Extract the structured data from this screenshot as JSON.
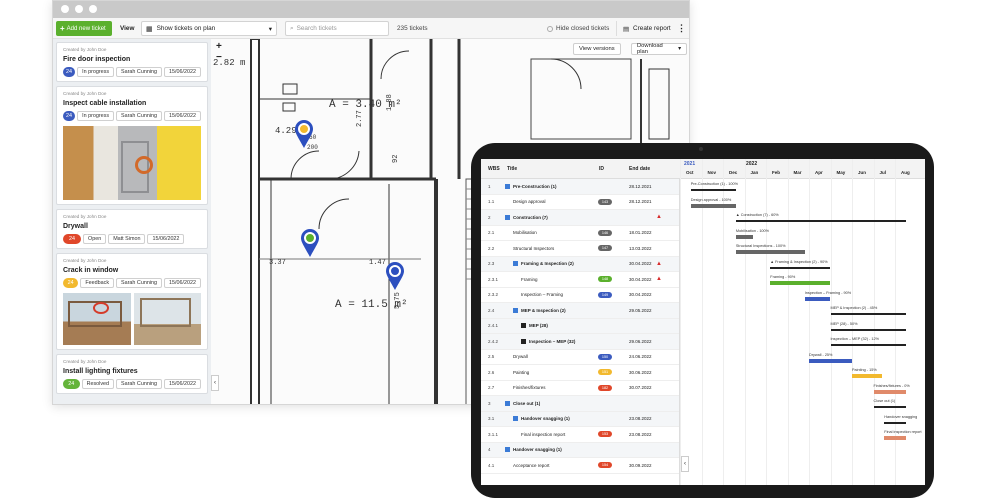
{
  "toolbar": {
    "add_ticket": "Add new ticket",
    "view_label": "View",
    "view_select": "Show tickets on plan",
    "search_placeholder": "Search tickets",
    "ticket_count": "235 tickets",
    "hide_closed": "Hide closed tickets",
    "create_report": "Create report"
  },
  "tickets": [
    {
      "creator": "Created by John Doe",
      "title": "Fire door inspection",
      "number": "24",
      "number_color": "#3b5bbf",
      "status": "In progress",
      "assignee": "Sarah Cunning",
      "date": "15/06/2022"
    },
    {
      "creator": "Created by John Doe",
      "title": "Inspect cable installation",
      "number": "24",
      "number_color": "#3b5bbf",
      "status": "In progress",
      "assignee": "Sarah Cunning",
      "date": "15/06/2022"
    },
    {
      "creator": "Created by John Doe",
      "title": "Drywall",
      "number": "24",
      "number_color": "#e0472a",
      "status": "Open",
      "assignee": "Matt Simon",
      "date": "15/06/2022"
    },
    {
      "creator": "Created by John Doe",
      "title": "Crack in window",
      "number": "24",
      "number_color": "#f2b92e",
      "status": "Feedback",
      "assignee": "Sarah Cunning",
      "date": "15/06/2022"
    },
    {
      "creator": "Created by John Doe",
      "title": "Install lighting fixtures",
      "number": "24",
      "number_color": "#64b43a",
      "status": "Resolved",
      "assignee": "Sarah Cunning",
      "date": "15/06/2022"
    }
  ],
  "plan": {
    "view_versions": "View versions",
    "download_plan": "Download plan",
    "dims": {
      "d1": "2.82 m",
      "d2": "A = 3.40 m²",
      "d3": "4.29",
      "d4": "A = 11.5 m²",
      "d5": "3.37",
      "d6": "1.47",
      "d7": "1.88",
      "d8": "2.77",
      "d9": "92",
      "d10": "5.75",
      "d11": "60",
      "d12": "200"
    }
  },
  "gantt": {
    "headers": {
      "wbs": "WBS",
      "title": "Title",
      "id": "ID",
      "end": "End date"
    },
    "years": [
      "2021",
      "2022"
    ],
    "months": [
      "Oct",
      "Nov",
      "Dec",
      "Jan",
      "Feb",
      "Mar",
      "Apr",
      "May",
      "Jun",
      "Jul",
      "Aug"
    ],
    "rows": [
      {
        "wbs": "1",
        "name": "Pre-Construction (1)",
        "group": true,
        "indent": 0,
        "id": "",
        "id_color": "",
        "end": "28.12.2021",
        "warn": false
      },
      {
        "wbs": "1.1",
        "name": "Design approval",
        "group": false,
        "indent": 1,
        "id": "143",
        "id_color": "#666",
        "end": "28.12.2021",
        "warn": false
      },
      {
        "wbs": "2",
        "name": "Construction (7)",
        "group": true,
        "indent": 0,
        "id": "",
        "id_color": "",
        "end": "",
        "warn": true
      },
      {
        "wbs": "2.1",
        "name": "Mobilisation",
        "group": false,
        "indent": 1,
        "id": "146",
        "id_color": "#666",
        "end": "18.01.2022",
        "warn": false
      },
      {
        "wbs": "2.2",
        "name": "Structural Inspectors",
        "group": false,
        "indent": 1,
        "id": "147",
        "id_color": "#666",
        "end": "13.03.2022",
        "warn": false
      },
      {
        "wbs": "2.3",
        "name": "Framing & Inspection (2)",
        "group": true,
        "indent": 1,
        "id": "",
        "id_color": "",
        "end": "30.04.2022",
        "warn": true
      },
      {
        "wbs": "2.3.1",
        "name": "Framing",
        "group": false,
        "indent": 2,
        "id": "148",
        "id_color": "#5bb02d",
        "end": "30.04.2022",
        "warn": true
      },
      {
        "wbs": "2.3.2",
        "name": "Inspection – Framing",
        "group": false,
        "indent": 2,
        "id": "149",
        "id_color": "#3b5bbf",
        "end": "30.04.2022",
        "warn": false
      },
      {
        "wbs": "2.4",
        "name": "MEP & Inspection (2)",
        "group": true,
        "indent": 1,
        "id": "",
        "id_color": "",
        "end": "29.05.2022",
        "warn": false
      },
      {
        "wbs": "2.4.1",
        "name": "MEP (28)",
        "group": true,
        "indent": 2,
        "id": "",
        "id_color": "",
        "end": "",
        "warn": false
      },
      {
        "wbs": "2.4.2",
        "name": "Inspection – MEP (32)",
        "group": true,
        "indent": 2,
        "id": "",
        "id_color": "",
        "end": "29.06.2022",
        "warn": false
      },
      {
        "wbs": "2.5",
        "name": "Drywall",
        "group": false,
        "indent": 1,
        "id": "150",
        "id_color": "#3b5bbf",
        "end": "24.06.2022",
        "warn": false
      },
      {
        "wbs": "2.6",
        "name": "Painting",
        "group": false,
        "indent": 1,
        "id": "151",
        "id_color": "#f2b92e",
        "end": "30.06.2022",
        "warn": false
      },
      {
        "wbs": "2.7",
        "name": "Finishes/fixtures",
        "group": false,
        "indent": 1,
        "id": "182",
        "id_color": "#e0472a",
        "end": "30.07.2022",
        "warn": false
      },
      {
        "wbs": "3",
        "name": "Close out (1)",
        "group": true,
        "indent": 0,
        "id": "",
        "id_color": "",
        "end": "",
        "warn": false
      },
      {
        "wbs": "3.1",
        "name": "Handover snagging (1)",
        "group": true,
        "indent": 1,
        "id": "",
        "id_color": "",
        "end": "23.08.2022",
        "warn": false
      },
      {
        "wbs": "3.1.1",
        "name": "Final inspection report",
        "group": false,
        "indent": 2,
        "id": "153",
        "id_color": "#e0472a",
        "end": "23.08.2022",
        "warn": false
      },
      {
        "wbs": "4",
        "name": "Handover snagging (1)",
        "group": true,
        "indent": 0,
        "id": "",
        "id_color": "",
        "end": "",
        "warn": false
      },
      {
        "wbs": "4.1",
        "name": "Acceptance report",
        "group": false,
        "indent": 1,
        "id": "154",
        "id_color": "#e0472a",
        "end": "30.09.2022",
        "warn": false
      }
    ],
    "bars": [
      {
        "label": "Pre-Construction (1) - 100%",
        "start": 0.5,
        "end": 2.6,
        "color": "#222",
        "thin": true,
        "row": 0
      },
      {
        "label": "Design approval - 100%",
        "start": 0.5,
        "end": 2.6,
        "color": "#666",
        "row": 1
      },
      {
        "label": "Construction (7) - 60%",
        "start": 2.6,
        "end": 10.5,
        "color": "#222",
        "thin": true,
        "row": 2,
        "warn": true
      },
      {
        "label": "Mobilisation - 100%",
        "start": 2.6,
        "end": 3.4,
        "color": "#666",
        "row": 3
      },
      {
        "label": "Structural Inspections - 100%",
        "start": 2.6,
        "end": 5.8,
        "color": "#666",
        "row": 4
      },
      {
        "label": "Framing & Inspection (2) - 90%",
        "start": 4.2,
        "end": 7.0,
        "color": "#222",
        "thin": true,
        "row": 5,
        "warn": true
      },
      {
        "label": "Framing - 90%",
        "start": 4.2,
        "end": 7.0,
        "color": "#5bb02d",
        "row": 6
      },
      {
        "label": "Inspection – Framing - 90%",
        "start": 5.8,
        "end": 7.0,
        "color": "#3b5bbf",
        "row": 7
      },
      {
        "label": "MEP & Inspection (2) - 45%",
        "start": 7.0,
        "end": 10.5,
        "color": "#222",
        "thin": true,
        "row": 8
      },
      {
        "label": "MEP (28) - 50%",
        "start": 7.0,
        "end": 10.5,
        "color": "#222",
        "thin": true,
        "row": 9
      },
      {
        "label": "Inspection – MEP (32) - 12%",
        "start": 7.0,
        "end": 10.5,
        "color": "#222",
        "thin": true,
        "row": 10
      },
      {
        "label": "Drywall - 25%",
        "start": 6.0,
        "end": 8.0,
        "color": "#3b5bbf",
        "row": 11
      },
      {
        "label": "Painting - 15%",
        "start": 8.0,
        "end": 9.4,
        "color": "#f2b92e",
        "row": 12
      },
      {
        "label": "Finishes/fixtures - 0%",
        "start": 9.0,
        "end": 10.5,
        "color": "#e08a6a",
        "row": 13
      },
      {
        "label": "Close out (1)",
        "start": 9.0,
        "end": 10.5,
        "color": "#222",
        "thin": true,
        "row": 14
      },
      {
        "label": "Handover snagging",
        "start": 9.5,
        "end": 10.5,
        "color": "#222",
        "thin": true,
        "row": 15
      },
      {
        "label": "Final inspection report",
        "start": 9.5,
        "end": 10.5,
        "color": "#e08a6a",
        "row": 16
      }
    ]
  }
}
